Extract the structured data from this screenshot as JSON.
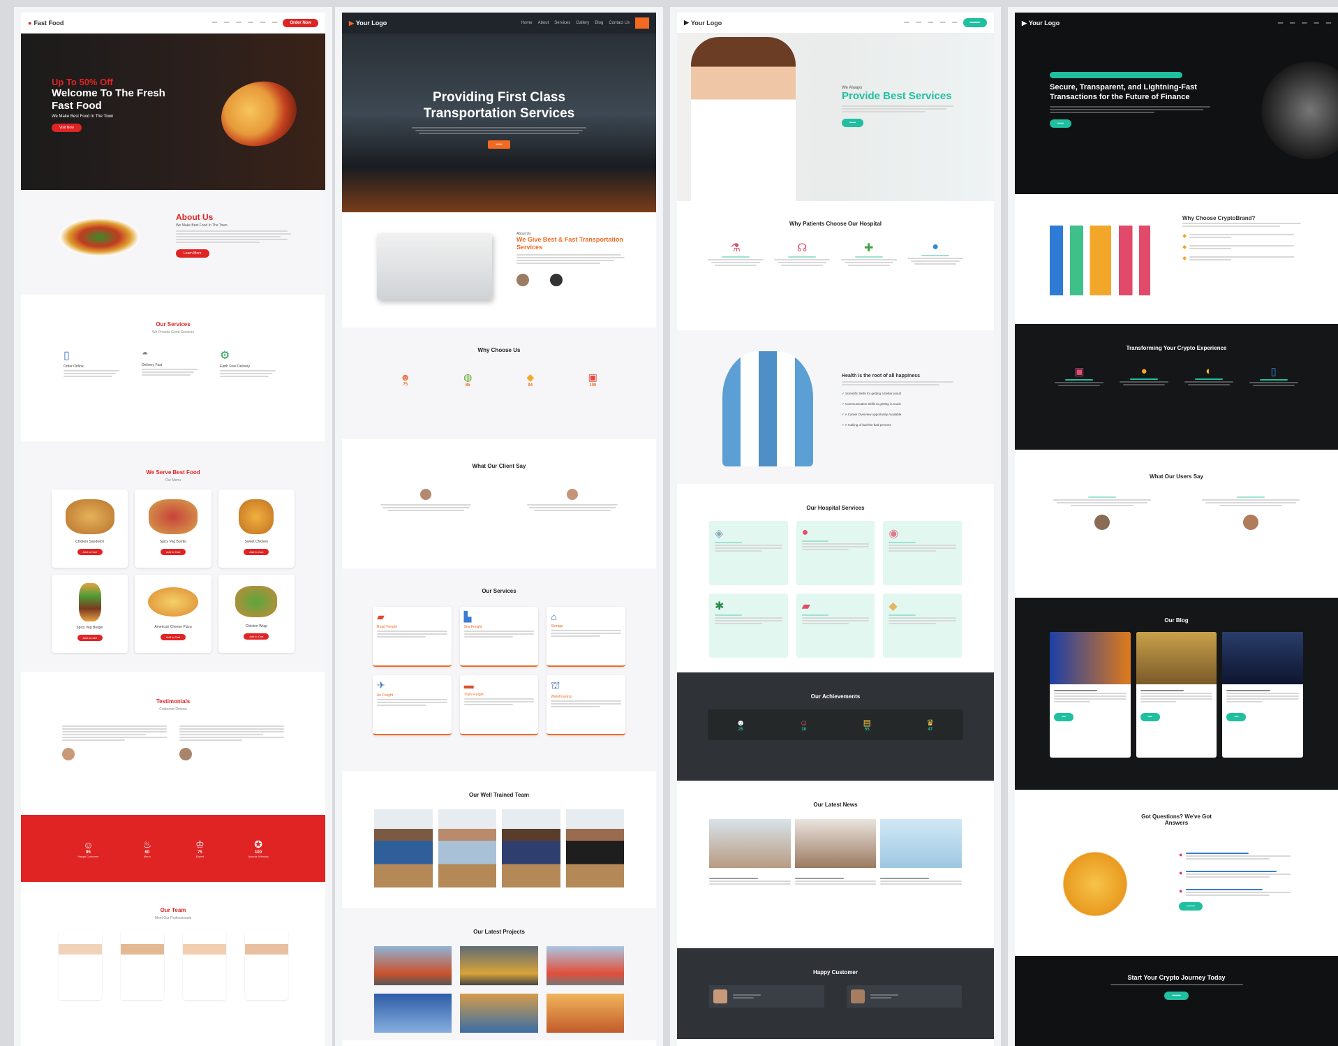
{
  "food": {
    "logo": "Fast Food",
    "nav_cta": "Order Now",
    "hero": {
      "promo": "Up To 50% Off",
      "title": "Welcome To The Fresh Fast Food",
      "subtitle": "We Make Best Food In The Town",
      "cta": "Visit Now"
    },
    "about": {
      "title": "About Us",
      "subtitle": "We Make Best Food In The Town",
      "cta": "Learn More"
    },
    "services": {
      "title": "Our Services",
      "subtitle": "We Provide Good Services",
      "items": [
        "Order Online",
        "Delivery Fast",
        "Earth Free Delivery"
      ]
    },
    "menu": {
      "title": "We Serve Best Food",
      "subtitle": "Our Menu",
      "items": [
        "Chicken Sandwich",
        "Spicy Veg Burrito",
        "Sweet Chicken",
        "Spicy Veg Burger",
        "American Cheese Pizza",
        "Chicken Wrap"
      ],
      "cta": "Add to Cart"
    },
    "testimonials": {
      "title": "Testimonials",
      "subtitle": "Customer Review"
    },
    "stats": [
      {
        "value": "95",
        "label": "Happy Customer"
      },
      {
        "value": "60",
        "label": "Menu"
      },
      {
        "value": "75",
        "label": "Expert"
      },
      {
        "value": "100",
        "label": "Awards Winning"
      }
    ],
    "team": {
      "title": "Our Team",
      "subtitle": "Meet Our Professionals"
    },
    "accent": "#e02424"
  },
  "transport": {
    "logo": "Your Logo",
    "nav": [
      "Home",
      "About",
      "Services",
      "Gallery",
      "Blog",
      "Contact Us"
    ],
    "hero": {
      "title": "Providing First Class Transportation Services"
    },
    "about": {
      "kicker": "About Us",
      "title": "We Give Best & Fast Transportation Services"
    },
    "why": {
      "title": "Why Choose Us",
      "stats": [
        "75",
        "85",
        "94",
        "100"
      ]
    },
    "clients": {
      "title": "What Our Client Say"
    },
    "services": {
      "title": "Our Services",
      "items": [
        "Road Freight",
        "Sea Freight",
        "Storage",
        "Air Freight",
        "Train Freight",
        "Warehousing"
      ]
    },
    "team": {
      "title": "Our Well Trained Team"
    },
    "projects": {
      "title": "Our Latest Projects"
    },
    "accent": "#f26a22"
  },
  "hospital": {
    "logo": "Your Logo",
    "hero": {
      "kicker": "We Always",
      "title": "Provide Best Services"
    },
    "why": {
      "title": "Why Patients Choose Our Hospital"
    },
    "about": {
      "title": "Health is the root of all happiness",
      "checks": [
        "Scientific Skills for getting a better result",
        "Communication Skills to getting in touch",
        "A Career Overview opportunity Available",
        "A making of bad the bad persons"
      ]
    },
    "services": {
      "title": "Our Hospital Services"
    },
    "achievements": {
      "title": "Our Achievements",
      "stats": [
        "25",
        "30",
        "55",
        "47"
      ]
    },
    "news": {
      "title": "Our Latest News"
    },
    "customers": {
      "title": "Happy Customer"
    },
    "accent": "#1fbfa0"
  },
  "crypto": {
    "logo": "Your Logo",
    "hero": {
      "title": "Secure, Transparent, and Lightning-Fast Transactions for the Future of Finance"
    },
    "why": {
      "title": "Why Choose CryptoBrand?"
    },
    "transform": {
      "title": "Transforming Your Crypto Experience"
    },
    "users": {
      "title": "What Our Users Say"
    },
    "blog": {
      "title": "Our Blog"
    },
    "faq": {
      "title": "Got Questions? We've Got Answers"
    },
    "cta": {
      "title": "Start Your Crypto Journey Today"
    },
    "accent": "#1fbfa0"
  }
}
